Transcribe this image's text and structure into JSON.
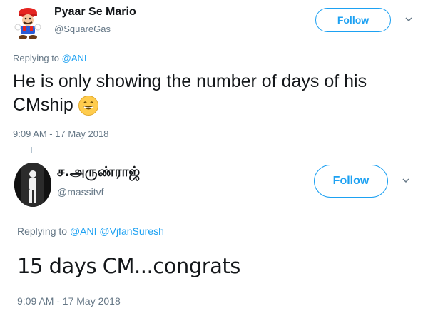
{
  "tweets": [
    {
      "display_name": "Pyaar Se Mario",
      "handle": "@SquareGas",
      "follow_label": "Follow",
      "replying_prefix": "Replying to ",
      "mentions": [
        "@ANI"
      ],
      "text": "He is only showing the number of days of his CMship",
      "emoji": "grinning-face-icon",
      "timestamp": "9:09 AM - 17 May 2018"
    },
    {
      "display_name": "ச.அருண்ராஜ்",
      "handle": "@massitvf",
      "follow_label": "Follow",
      "replying_prefix": "Replying to ",
      "mentions": [
        "@ANI",
        "@VjfanSuresh"
      ],
      "text": "15 days CM...congrats",
      "timestamp": "9:09 AM - 17 May 2018"
    }
  ],
  "colors": {
    "accent": "#1da1f2",
    "text": "#14171a",
    "secondary": "#657786"
  }
}
